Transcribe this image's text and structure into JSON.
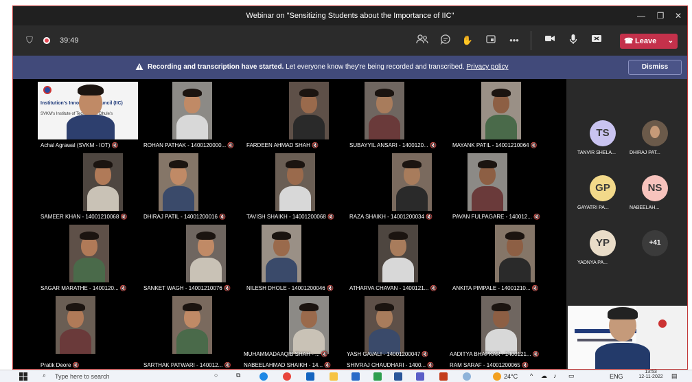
{
  "window": {
    "title": "Webinar on \"Sensitizing Students about the Importance of IIC\""
  },
  "toolbar": {
    "timer": "39:49",
    "leave_label": "Leave"
  },
  "banner": {
    "bold_text": "Recording and transcription have started.",
    "text": "Let everyone know they're being recorded and transcribed.",
    "link": "Privacy policy",
    "dismiss_label": "Dismiss"
  },
  "tiles": [
    {
      "name": "Achal Agrawal (SVKM - IOT)",
      "kind": "slide"
    },
    {
      "name": "ROHAN PATHAK - 1400120000..."
    },
    {
      "name": "FARDEEN AHMAD SHAH"
    },
    {
      "name": "SUBAYYIL ANSARI - 1400120..."
    },
    {
      "name": "MAYANK PATIL - 14001210064"
    },
    {
      "name": "SAMEER KHAN - 14001210068"
    },
    {
      "name": "DHIRAJ PATIL - 14001200016"
    },
    {
      "name": "TAVISH SHAIKH - 14001200068"
    },
    {
      "name": "RAZA SHAIKH - 14001200034"
    },
    {
      "name": "PAVAN FULPAGARE - 140012..."
    },
    {
      "name": "SAGAR MARATHE - 1400120..."
    },
    {
      "name": "SANKET WAGH - 14001210076"
    },
    {
      "name": "NILESH DHOLE - 14001200046"
    },
    {
      "name": "ATHARVA CHAVAN - 1400121..."
    },
    {
      "name": "ANKITA PIMPALE - 14001210..."
    },
    {
      "name": "Pratik Deore"
    },
    {
      "name": "SARTHAK PATWARI - 140012..."
    },
    {
      "name": "MUHAMMADAAQIB SHAH - ..."
    },
    {
      "name": "YASH GAVALI - 14001200047"
    },
    {
      "name": "AADITYA BHAPKAR - 1400121..."
    },
    {
      "name": "NABEELAHMAD SHAIKH - 14..."
    },
    {
      "name": "SHIVRAJ CHAUDHARI - 1400..."
    },
    {
      "name": "RAM SARAF - 14001200065"
    }
  ],
  "slide": {
    "line1": "Institution's Innovation Council (IIC)",
    "line2": "SVKM's Institute of Technology, Dhule's"
  },
  "participants": [
    {
      "initials": "TS",
      "name": "TANVIR SHELA...",
      "color": "#c9c3f0"
    },
    {
      "initials": "",
      "name": "DHIRAJ PAT...",
      "color": "#6b5a4a"
    },
    {
      "initials": "GP",
      "name": "GAYATRI PA...",
      "color": "#f2d98a"
    },
    {
      "initials": "NS",
      "name": "NABEELAH...",
      "color": "#f7c3bd"
    },
    {
      "initials": "YP",
      "name": "YADNYA PA...",
      "color": "#e9dcc8"
    },
    {
      "initials": "+41",
      "name": "",
      "color": "#3b3b3b"
    }
  ],
  "taskbar": {
    "search_placeholder": "Type here to search",
    "weather": "24°C",
    "lang": "ENG",
    "time": "13:53",
    "date": "12-11-2022"
  },
  "colors": {
    "leave": "#c4314b",
    "banner": "#414a7a",
    "stage": "#000000"
  }
}
